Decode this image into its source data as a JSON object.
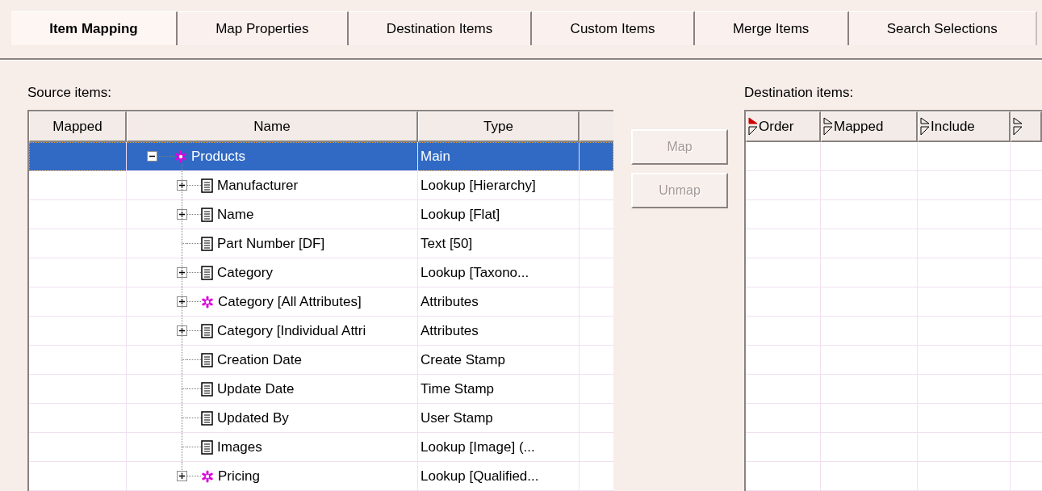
{
  "tabs": [
    {
      "label": "Item Mapping",
      "selected": true
    },
    {
      "label": "Map Properties",
      "selected": false
    },
    {
      "label": "Destination Items",
      "selected": false
    },
    {
      "label": "Custom Items",
      "selected": false
    },
    {
      "label": "Merge Items",
      "selected": false
    },
    {
      "label": "Search Selections",
      "selected": false
    }
  ],
  "source": {
    "label": "Source items:",
    "columns": [
      "Mapped",
      "Name",
      "Type"
    ],
    "tree": [
      {
        "name": "Products",
        "type": "Main",
        "kind": "group",
        "selected": true,
        "expanded": true,
        "children": [
          {
            "name": "Manufacturer",
            "type": "Lookup [Hierarchy]",
            "kind": "field",
            "selected": false,
            "expanded": false
          },
          {
            "name": "Name",
            "type": "Lookup [Flat]",
            "kind": "field",
            "selected": false,
            "expanded": false
          },
          {
            "name": "Part Number [DF]",
            "type": "Text [50]",
            "kind": "field",
            "selected": false
          },
          {
            "name": "Category",
            "type": "Lookup [Taxono...",
            "kind": "field",
            "selected": false,
            "expanded": false
          },
          {
            "name": "Category [All Attributes]",
            "type": "Attributes",
            "kind": "group",
            "selected": false,
            "expanded": false
          },
          {
            "name": "Category [Individual Attri",
            "type": "Attributes",
            "kind": "field",
            "selected": false,
            "expanded": false
          },
          {
            "name": "Creation Date",
            "type": "Create Stamp",
            "kind": "field",
            "selected": false
          },
          {
            "name": "Update Date",
            "type": "Time Stamp",
            "kind": "field",
            "selected": false
          },
          {
            "name": "Updated By",
            "type": "User Stamp",
            "kind": "field",
            "selected": false
          },
          {
            "name": "Images",
            "type": "Lookup [Image] (...",
            "kind": "field",
            "selected": false
          },
          {
            "name": "Pricing",
            "type": "Lookup [Qualified...",
            "kind": "group",
            "selected": false,
            "expanded": false
          }
        ]
      }
    ]
  },
  "actions": [
    {
      "label": "Map",
      "disabled": true
    },
    {
      "label": "Unmap",
      "disabled": true
    }
  ],
  "destination": {
    "label": "Destination items:",
    "columns": [
      {
        "label": "Order",
        "sorted": true
      },
      {
        "label": "Mapped",
        "sorted": false
      },
      {
        "label": "Include",
        "sorted": false
      },
      {
        "sorted": false
      }
    ]
  }
}
